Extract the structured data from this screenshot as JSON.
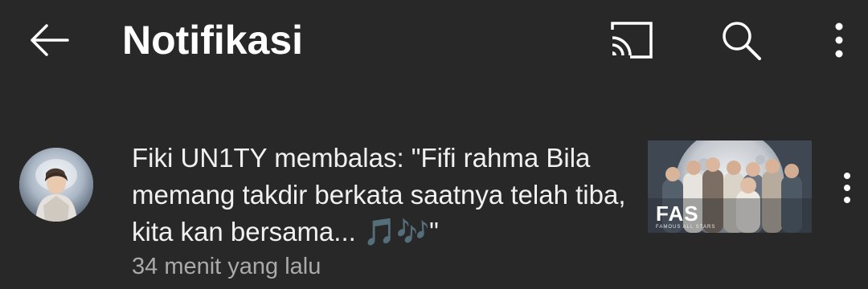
{
  "appbar": {
    "title": "Notifikasi",
    "back_icon": "arrow-left-icon",
    "cast_icon": "cast-icon",
    "search_icon": "search-icon",
    "more_icon": "more-vert-icon"
  },
  "notifications": [
    {
      "text": "Fiki UN1TY membalas: \"Fifi rahma Bila memang takdir berkata saatnya telah tiba, kita kan bersama... 🎵🎶\"",
      "time": "34 menit yang lalu",
      "avatar_icon": "user-avatar",
      "thumbnail": {
        "logo": "FAS",
        "subtitle": "FAMOUS ALL STARS"
      },
      "more_icon": "more-vert-icon"
    }
  ],
  "colors": {
    "background": "#282828",
    "primary_text": "#ffffff",
    "secondary_text": "#aaaaaa",
    "note_blue": "#3ea6ff"
  }
}
